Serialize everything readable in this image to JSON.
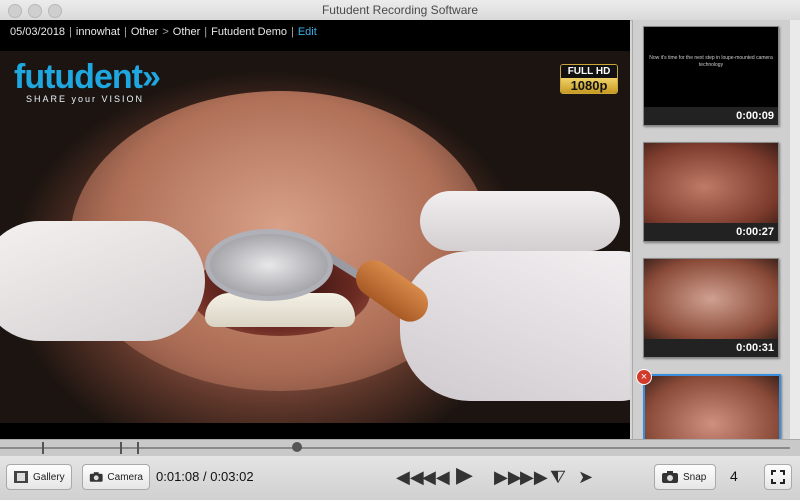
{
  "window": {
    "title": "Futudent Recording Software"
  },
  "info_bar": {
    "date": "05/03/2018",
    "user": "innowhat",
    "category": "Other",
    "subcategory": "Other",
    "project": "Futudent Demo",
    "edit_label": "Edit",
    "separator": "|",
    "arrow": ">"
  },
  "video": {
    "logo_text": "futudent»",
    "logo_tagline": "SHARE your VISION",
    "badge_top": "FULL HD",
    "badge_bottom": "1080p"
  },
  "gallery": {
    "thumbnails": [
      {
        "time": "0:00:09",
        "caption": "Now it's time for the next step in loupe-mounted camera technology"
      },
      {
        "time": "0:00:27"
      },
      {
        "time": "0:00:31"
      },
      {
        "time": ""
      }
    ]
  },
  "toolbar": {
    "gallery_label": "Gallery",
    "camera_label": "Camera",
    "timecode": "0:01:08 / 0:03:02",
    "snap_label": "Snap",
    "snap_count": "4"
  }
}
